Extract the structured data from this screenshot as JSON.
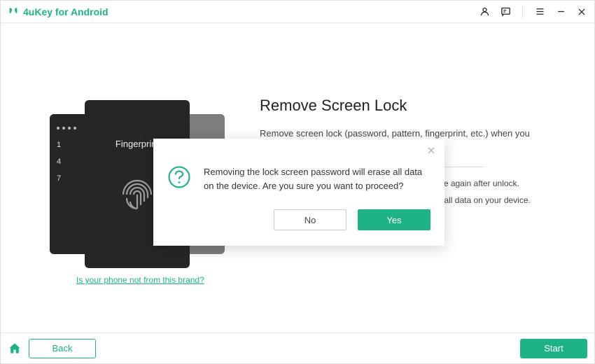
{
  "app": {
    "title": "4uKey for Android"
  },
  "titlebar_icons": [
    "person",
    "feedback",
    "menu",
    "minimize",
    "close"
  ],
  "main": {
    "heading": "Remove Screen Lock",
    "description": "Remove screen lock (password, pattern, fingerprint, etc.) when you forgot it.",
    "bullets": [
      "Continue in this way you may need to set phone again after unlock.",
      "Removing the lock screen password will erase all data on your device."
    ]
  },
  "phone": {
    "fingerprint_label": "Fingerprint",
    "left_rows": [
      "1",
      "4",
      "7"
    ]
  },
  "brand_link": "Is your phone not from this brand?",
  "footer": {
    "back": "Back",
    "start": "Start"
  },
  "dialog": {
    "message": "Removing the lock screen password will erase all data on the device. Are you sure you want to proceed?",
    "no": "No",
    "yes": "Yes"
  },
  "colors": {
    "accent": "#1eb386"
  }
}
